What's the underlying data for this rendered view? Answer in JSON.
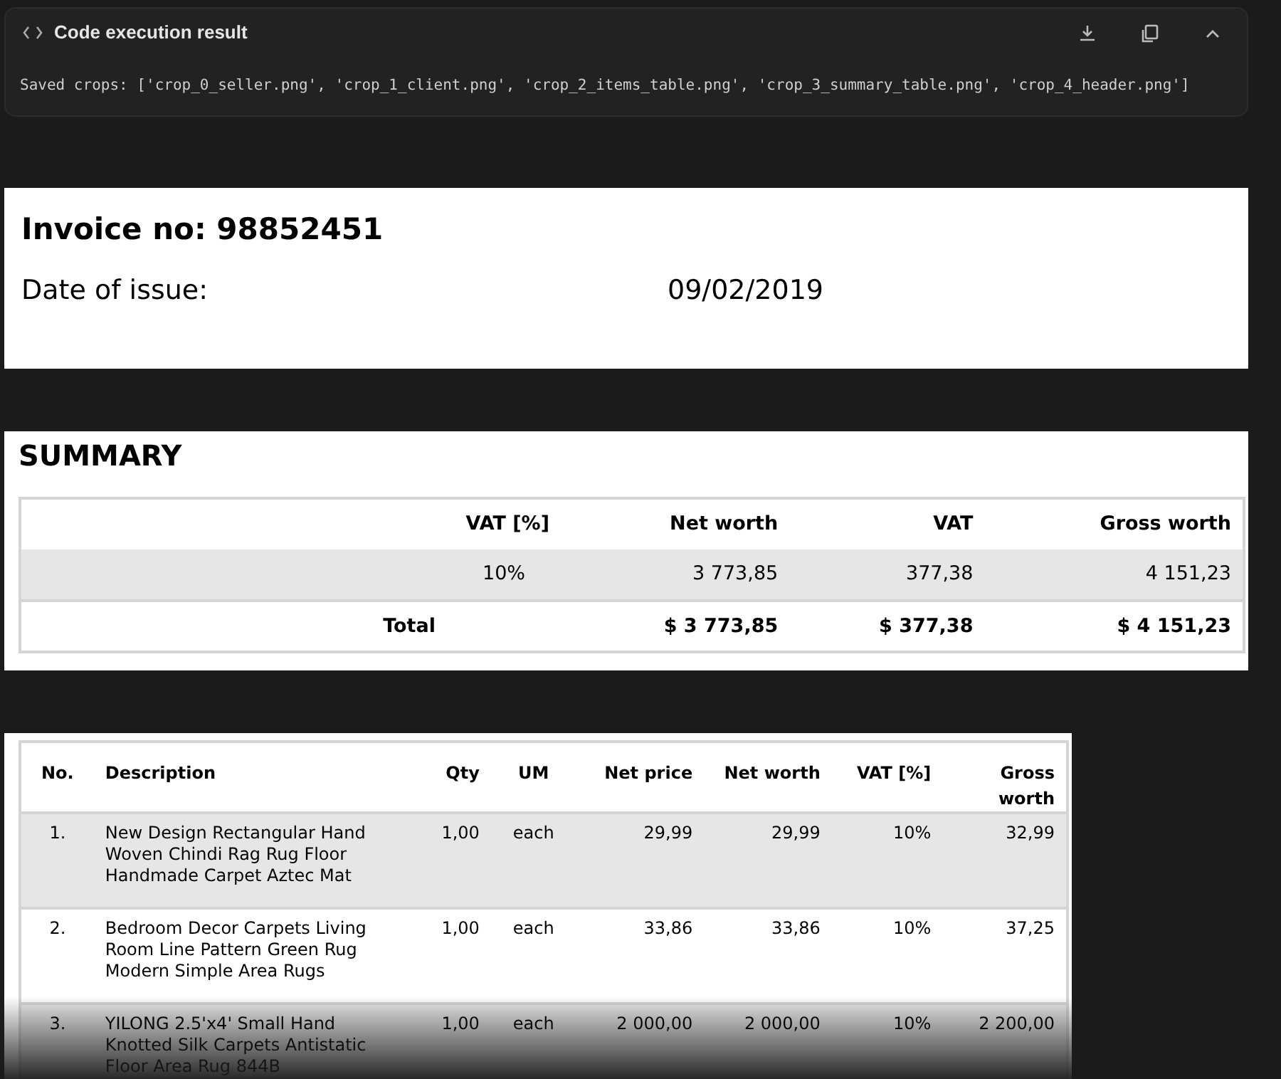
{
  "result_panel": {
    "title": "Code execution result",
    "output": "Saved crops: ['crop_0_seller.png', 'crop_1_client.png', 'crop_2_items_table.png', 'crop_3_summary_table.png', 'crop_4_header.png']"
  },
  "header": {
    "invoice_no": "Invoice no: 98852451",
    "date_label": "Date of issue:",
    "date_value": "09/02/2019"
  },
  "summary": {
    "title": "SUMMARY",
    "columns": [
      "",
      "VAT [%]",
      "Net worth",
      "VAT",
      "Gross worth"
    ],
    "rows": [
      {
        "kind": "rate",
        "cells": [
          "",
          "10%",
          "3 773,85",
          "377,38",
          "4 151,23"
        ]
      },
      {
        "kind": "total",
        "cells": [
          "Total",
          "",
          "$ 3 773,85",
          "$ 377,38",
          "$ 4 151,23"
        ]
      }
    ]
  },
  "items": {
    "columns": [
      "No.",
      "Description",
      "Qty",
      "UM",
      "Net price",
      "Net worth",
      "VAT [%]",
      "Gross worth"
    ],
    "rows": [
      [
        "1.",
        "New Design Rectangular Hand Woven Chindi Rag Rug Floor Handmade Carpet Aztec Mat",
        "1,00",
        "each",
        "29,99",
        "29,99",
        "10%",
        "32,99"
      ],
      [
        "2.",
        "Bedroom Decor Carpets Living Room Line Pattern Green Rug Modern Simple Area Rugs",
        "1,00",
        "each",
        "33,86",
        "33,86",
        "10%",
        "37,25"
      ],
      [
        "3.",
        "YILONG 2.5'x4' Small Hand Knotted Silk Carpets Antistatic Floor Area Rug 844B",
        "1,00",
        "each",
        "2 000,00",
        "2 000,00",
        "10%",
        "2 200,00"
      ]
    ]
  }
}
